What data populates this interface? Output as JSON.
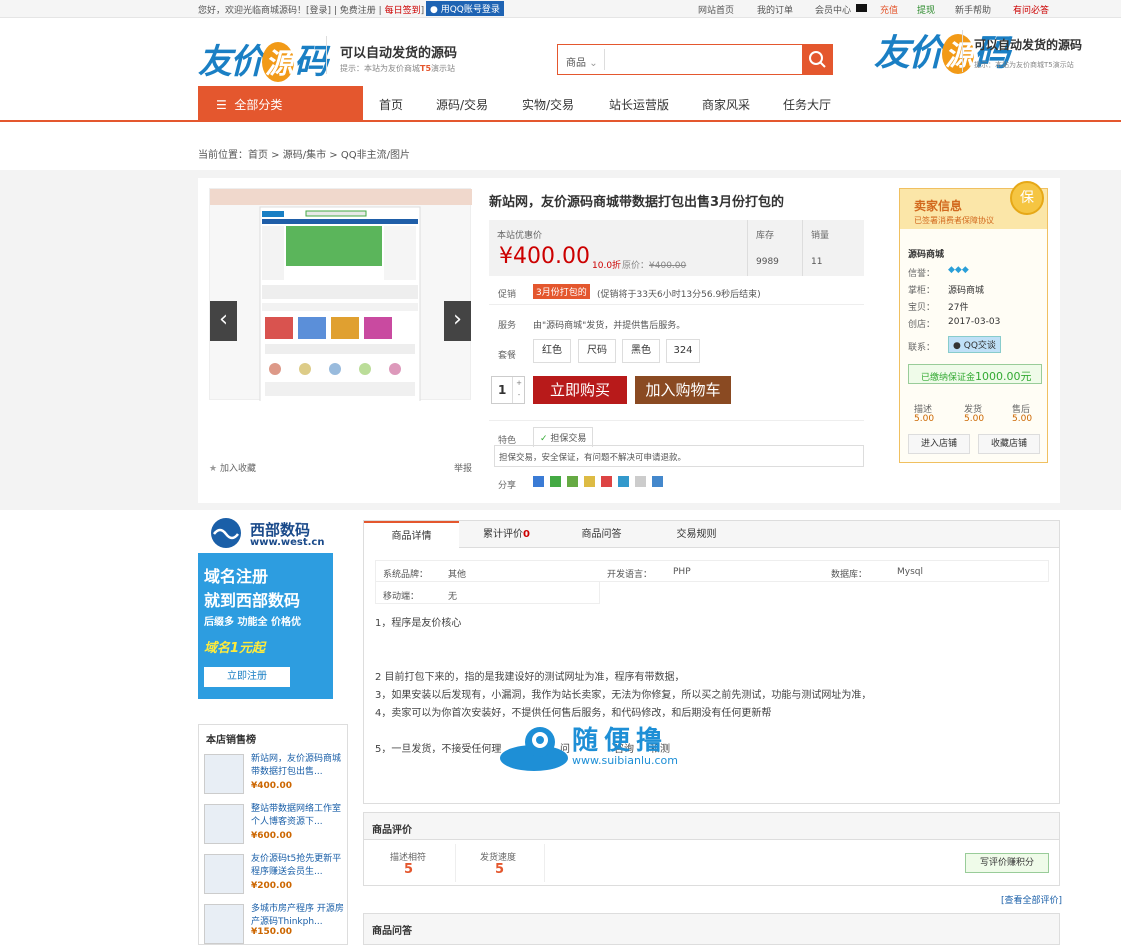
{
  "topbar": {
    "welcome": "您好，欢迎光临商城源码！[",
    "login": "登录",
    "sep1": "] | ",
    "register": "免费注册",
    "sep2": " | ",
    "sign": "每日签到",
    "sep3": "]",
    "qq_login": "用QQ账号登录",
    "home": "网站首页",
    "orders": "我的订单",
    "member": "会员中心",
    "recharge": "充值",
    "withdraw": "提现",
    "help": "新手帮助",
    "must_read": "有问必答"
  },
  "header": {
    "logo_a": "友价",
    "logo_mid": "源",
    "logo_b": "码",
    "slogan": "可以自动发货的源码",
    "tip_prefix": "提示：本站为友价商城",
    "tip_suffix": "演示站",
    "tip_t": "T5",
    "search_type": "商品",
    "right_slogan": "可以自动发货的源码",
    "right_tip": "提示：本站为友价商城T5演示站"
  },
  "nav": {
    "category": "全部分类",
    "items": [
      "首页",
      "源码/交易",
      "实物/交易",
      "站长运营版",
      "商家风采",
      "任务大厅"
    ]
  },
  "breadcrumb": "当前位置：首页 > 源码/集市 > QQ非主流/图片",
  "product": {
    "title": "新站网，友价源码商城带数据打包出售3月份打包的",
    "price_label": "本站优惠价",
    "price": "¥400.00",
    "discount": "10.0折",
    "orig_label": "原价：",
    "orig_price": "¥400.00",
    "stock_label": "库存",
    "stock": "9989",
    "sales_label": "销量",
    "sales": "11",
    "promo_label": "促销",
    "promo_tag": "3月份打包的",
    "promo_text": "(促销将于33天6小时13分56.9秒后结束)",
    "service_label": "服务",
    "service_text": "由\"源码商城\"发货，并提供售后服务。",
    "package_label": "套餐",
    "options": [
      "红色",
      "尺码",
      "黑色",
      "324"
    ],
    "qty": "1",
    "buy": "立即购买",
    "cart": "加入购物车",
    "feature_label": "特色",
    "feature_tag": "担保交易",
    "feature_text": "担保交易，安全保证，有问题不解决可申请退款。",
    "share_label": "分享",
    "favorite": "加入收藏",
    "report": "举报"
  },
  "seller": {
    "title": "卖家信息",
    "subtitle": "已签署消费者保障协议",
    "badge": "保",
    "shop": "源码商城",
    "credit_label": "信誉：",
    "keeper_label": "掌柜：",
    "keeper": "源码商城",
    "items_label": "宝贝：",
    "items": "27件",
    "open_label": "创店：",
    "open": "2017-03-03",
    "contact_label": "联系：",
    "qq": "QQ交谈",
    "deposit_prefix": "已缴纳保证金",
    "deposit": "1000.00元",
    "desc_label": "描述",
    "desc": "5.00",
    "ship_label": "发货",
    "ship": "5.00",
    "after_label": "售后",
    "after": "5.00",
    "enter": "进入店铺",
    "collect": "收藏店铺"
  },
  "ad": {
    "brand": "西部数码",
    "url": "www.west.cn",
    "line1": "域名注册",
    "line2": "就到西部数码",
    "line3": "后缀多 功能全 价格优",
    "line4": "域名1元起",
    "btn": "立即注册"
  },
  "tabs": [
    "商品详情",
    "累计评价",
    "商品问答",
    "交易规则"
  ],
  "review_count": "0",
  "specs": [
    {
      "k": "系统品牌：",
      "v": "其他"
    },
    {
      "k": "开发语言：",
      "v": "PHP"
    },
    {
      "k": "数据库：",
      "v": "Mysql"
    },
    {
      "k": "移动端：",
      "v": "无"
    }
  ],
  "details": [
    "1，程序是友价核心",
    "2 目前打包下来的，指的是我建设好的测试网址为准，程序有带数据，",
    "3，如果安装以后发现有，小漏洞，我作为站长卖家，无法为你修复，所以买之前先测试，功能与测试网址为准，",
    "4，卖家可以为你首次安装好，不提供任何售后服务，和代码修改，和后期没有任何更新帮",
    "5，一旦发货，不接受任何理",
    "问",
    "咨询",
    "和测"
  ],
  "watermark": {
    "text": "随便撸",
    "url": "www.suibianlu.com"
  },
  "rank": {
    "title": "本店销售榜",
    "items": [
      {
        "title": "新站网，友价源码商城带数据打包出售...",
        "price": "¥400.00"
      },
      {
        "title": "整站带数据网络工作室个人博客资源下...",
        "price": "¥600.00"
      },
      {
        "title": "友价源码t5抢先更新平程序赚送会员生...",
        "price": "¥200.00"
      },
      {
        "title": "多城市房产程序 开源房产源码Thinkph...",
        "price": "¥150.00"
      }
    ]
  },
  "reviews": {
    "title": "商品评价",
    "match_label": "描述相符",
    "match": "5",
    "speed_label": "发货速度",
    "speed": "5",
    "write": "写评价赚积分",
    "all": "[查看全部评价]"
  },
  "qa": {
    "title": "商品问答"
  }
}
